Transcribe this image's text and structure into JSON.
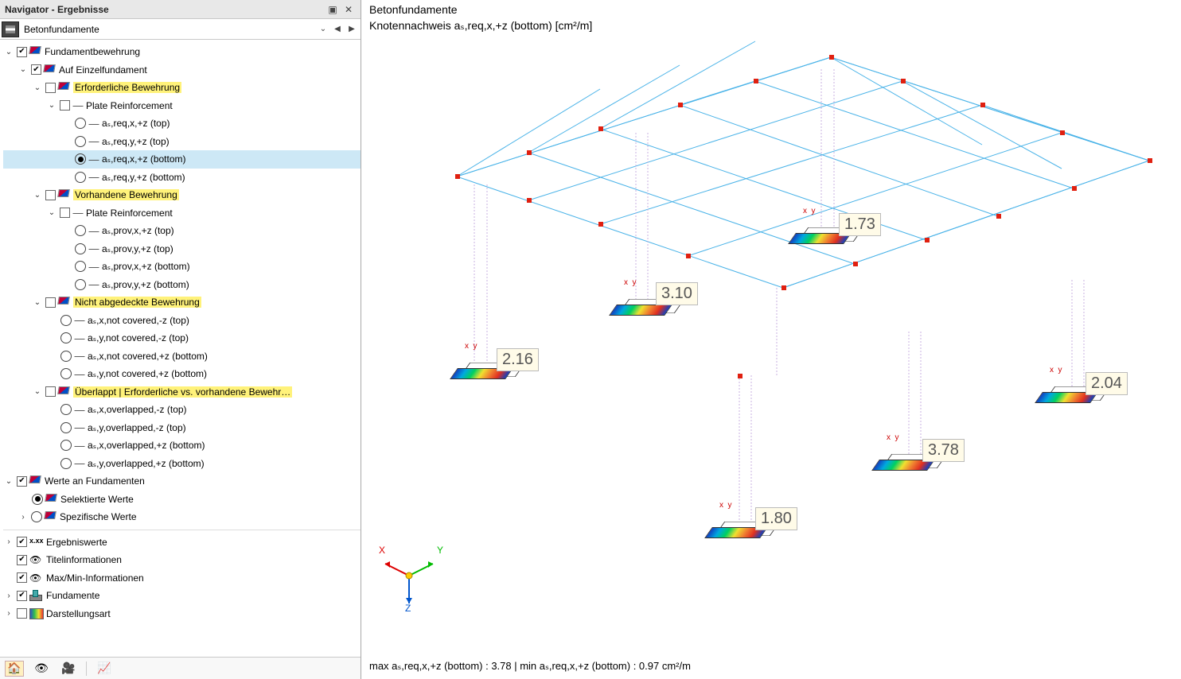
{
  "titlebar": {
    "title": "Navigator - Ergebnisse"
  },
  "dropdown": {
    "label": "Betonfundamente"
  },
  "tree": {
    "root": "Fundamentbewehrung",
    "n1": "Auf Einzelfundament",
    "n2": "Erforderliche Bewehrung",
    "n3": "Plate Reinforcement",
    "r1": "aₛ,req,x,+z (top)",
    "r2": "aₛ,req,y,+z (top)",
    "r3": "aₛ,req,x,+z (bottom)",
    "r4": "aₛ,req,y,+z (bottom)",
    "n4": "Vorhandene Bewehrung",
    "n5": "Plate Reinforcement",
    "p1": "aₛ,prov,x,+z (top)",
    "p2": "aₛ,prov,y,+z (top)",
    "p3": "aₛ,prov,x,+z (bottom)",
    "p4": "aₛ,prov,y,+z (bottom)",
    "n6": "Nicht abgedeckte Bewehrung",
    "c1": "aₛ,x,not covered,-z (top)",
    "c2": "aₛ,y,not covered,-z (top)",
    "c3": "aₛ,x,not covered,+z (bottom)",
    "c4": "aₛ,y,not covered,+z (bottom)",
    "n7": "Überlappt | Erforderliche vs. vorhandene Bewehr…",
    "o1": "aₛ,x,overlapped,-z (top)",
    "o2": "aₛ,y,overlapped,-z (top)",
    "o3": "aₛ,x,overlapped,+z (bottom)",
    "o4": "aₛ,y,overlapped,+z (bottom)",
    "w": "Werte an Fundamenten",
    "w1": "Selektierte Werte",
    "w2": "Spezifische Werte",
    "b1": "Ergebniswerte",
    "b2": "Titelinformationen",
    "b3": "Max/Min-Informationen",
    "b4": "Fundamente",
    "b5": "Darstellungsart"
  },
  "main": {
    "title": "Betonfundamente",
    "subtitle": "Knotennachweis aₛ,req,x,+z (bottom) [cm²/m]",
    "status": "max aₛ,req,x,+z (bottom) : 3.78 | min aₛ,req,x,+z (bottom) : 0.97 cm²/m",
    "labels": {
      "v1": "1.73",
      "v2": "3.10",
      "v3": "2.16",
      "v4": "2.04",
      "v5": "3.78",
      "v6": "1.80"
    },
    "axes": {
      "x": "X",
      "y": "Y",
      "z": "Z"
    }
  }
}
